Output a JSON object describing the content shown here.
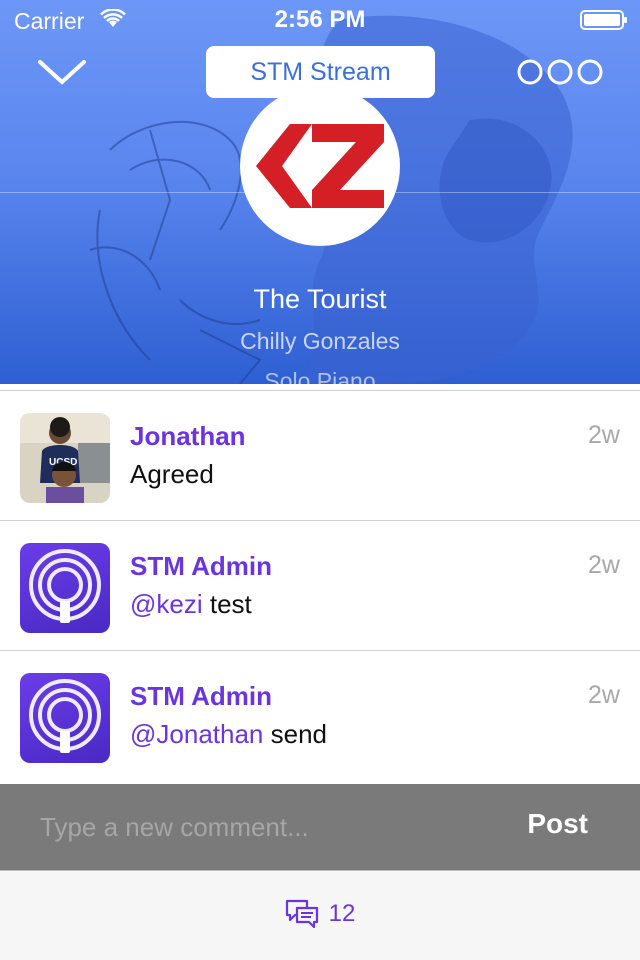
{
  "status_bar": {
    "carrier": "Carrier",
    "time": "2:56 PM"
  },
  "header": {
    "stream_label": "STM Stream",
    "logo_icon": "kz-logo-icon",
    "track_title": "The Tourist",
    "artist": "Chilly Gonzales",
    "album": "Solo Piano"
  },
  "comments": [
    {
      "author": "Jonathan",
      "mention": "",
      "text": "Agreed",
      "time": "2w",
      "avatar": "photo-avatar"
    },
    {
      "author": "STM Admin",
      "mention": "@kezi",
      "text": " test",
      "time": "2w",
      "avatar": "broadcast-avatar-icon"
    },
    {
      "author": "STM Admin",
      "mention": "@Jonathan",
      "text": " send",
      "time": "2w",
      "avatar": "broadcast-avatar-icon"
    }
  ],
  "composer": {
    "placeholder": "Type a new comment...",
    "post_label": "Post"
  },
  "footer": {
    "comment_count": "12"
  },
  "colors": {
    "accent": "#6a35e0",
    "header_blue": "#5a86ee",
    "input_bar": "#7a7a7a"
  }
}
